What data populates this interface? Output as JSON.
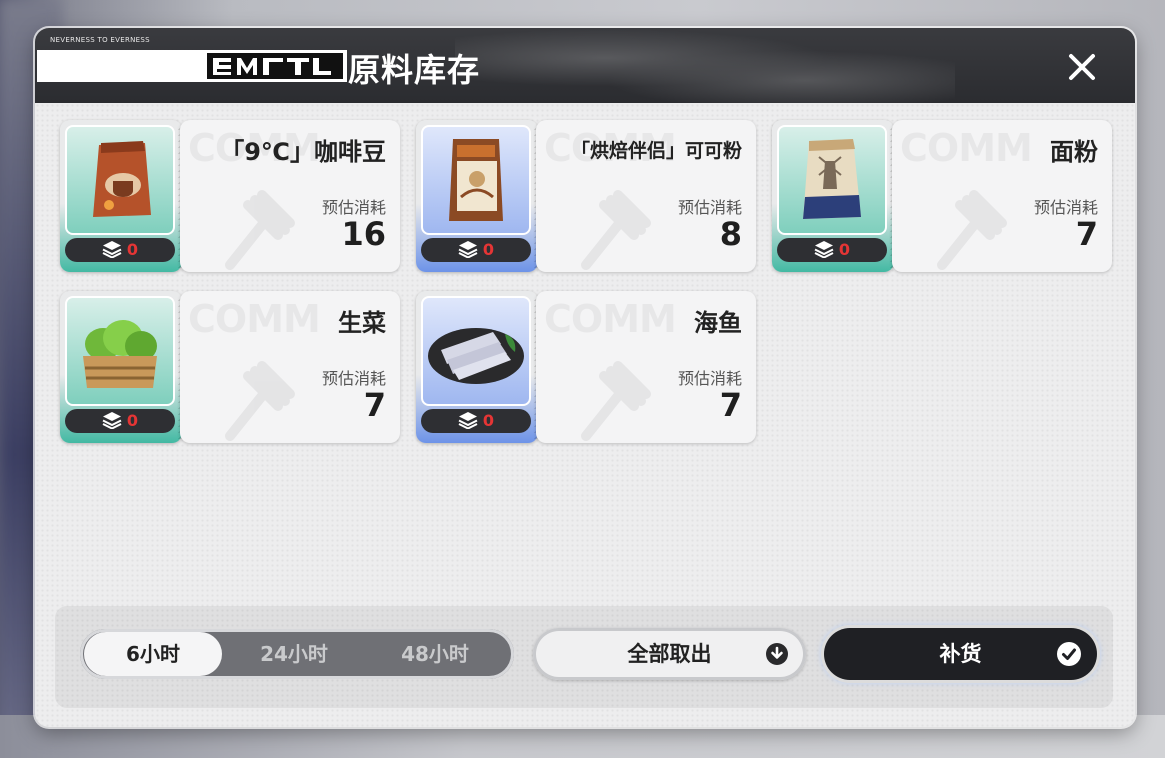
{
  "header": {
    "brand": "NEVERNESS TO EVERNESS",
    "title": "原料库存",
    "close_icon": "close-icon"
  },
  "inventory": {
    "estimate_label": "预估消耗",
    "items": [
      {
        "name": "「9℃」咖啡豆",
        "stock": "0",
        "estimate": "16",
        "rarity_color": "#43b9a3",
        "icon": "coffee-bag-icon"
      },
      {
        "name": "「烘焙伴侣」可可粉",
        "stock": "0",
        "estimate": "8",
        "rarity_color": "#6d93e8",
        "icon": "cocoa-pouch-icon"
      },
      {
        "name": "面粉",
        "stock": "0",
        "estimate": "7",
        "rarity_color": "#43b9a3",
        "icon": "flour-bag-icon"
      },
      {
        "name": "生菜",
        "stock": "0",
        "estimate": "7",
        "rarity_color": "#43b9a3",
        "icon": "lettuce-crate-icon"
      },
      {
        "name": "海鱼",
        "stock": "0",
        "estimate": "7",
        "rarity_color": "#6d93e8",
        "icon": "fish-plate-icon"
      }
    ]
  },
  "footer": {
    "durations": [
      "6小时",
      "24小时",
      "48小时"
    ],
    "selected_duration": "6小时",
    "take_all_label": "全部取出",
    "restock_label": "补货"
  }
}
